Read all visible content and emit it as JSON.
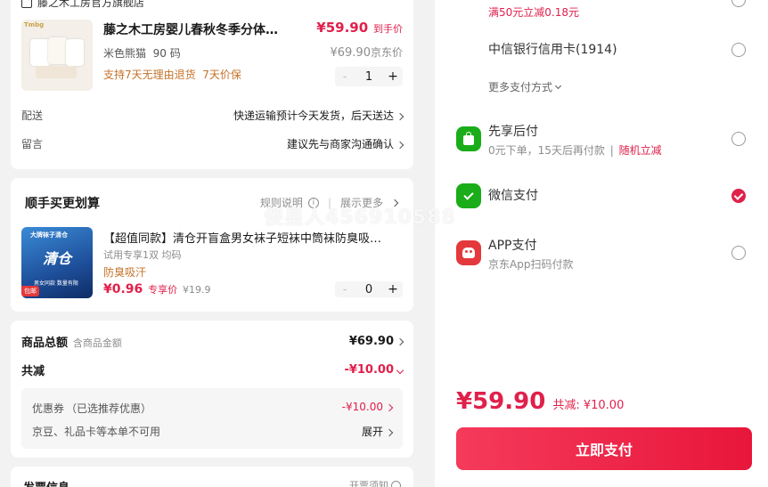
{
  "shop": {
    "name": "藤之木工房官方旗舰店"
  },
  "product": {
    "title": "藤之木工房婴儿春秋冬季分体…",
    "price": "¥59.90",
    "price_tag": "到手价",
    "spec": "米色熊猫  90 码",
    "jd_price": "¥69.90",
    "jd_price_tag": "京东价",
    "service": "支持7天无理由退货  7天价保",
    "quantity": "1",
    "minus": "-",
    "plus": "+",
    "thumb_brand": "Tmbg"
  },
  "delivery": {
    "label": "配送",
    "value": "快递运输预计今天发货，后天送达"
  },
  "message": {
    "label": "留言",
    "value": "建议先与商家沟通确认"
  },
  "bundle": {
    "title": "顺手买更划算",
    "rules": "规则说明",
    "more": "展示更多",
    "item_title": "【超值同款】清仓开盲盒男女袜子短袜中筒袜防臭吸…",
    "item_spec": "试用专享1双 均码",
    "item_feature": "防臭吸汗",
    "item_price": "¥0.96",
    "item_price_tag": "专享价",
    "item_orig": "¥19.9",
    "quantity": "0",
    "thumb_text_top": "大牌袜子清仓",
    "thumb_text_main": "清仓",
    "thumb_text_sub": "男女同款 数量有限",
    "thumb_badge": "包邮"
  },
  "summary": {
    "total_label": "商品总额",
    "total_sub": "含商品金额",
    "total_value": "¥69.90",
    "discount_label": "共减",
    "discount_value": "-¥10.00",
    "coupon_label": "优惠券",
    "coupon_note": "（已选推荐优惠）",
    "coupon_value": "-¥10.00",
    "jd_bean_label": "京豆、礼品卡等本单不可用",
    "expand": "展开"
  },
  "invoice": {
    "title": "发票信息",
    "note": "开票须知"
  },
  "payment": {
    "promo_text": "满50元立减0.18元",
    "bank_card": "中信银行信用卡(1914)",
    "more_methods": "更多支付方式",
    "methods": [
      {
        "name": "先享后付",
        "desc": "0元下单，15天后再付款",
        "extra": "随机立减",
        "icon": "bag-icon",
        "color": "#1aad19",
        "selected": false
      },
      {
        "name": "微信支付",
        "desc": "",
        "extra": "",
        "icon": "wechat-icon",
        "color": "#1aad19",
        "selected": true
      },
      {
        "name": "APP支付",
        "desc": "京东App扫码付款",
        "extra": "",
        "icon": "jd-dog-icon",
        "color": "#e4393c",
        "selected": false
      }
    ],
    "final_price": "¥59.90",
    "final_discount": "共减: ¥10.00",
    "pay_button": "立即支付"
  },
  "watermark": "傻星人456910588",
  "colors": {
    "accent": "#e0204b",
    "wechat": "#1aad19",
    "background": "#f2f2f2"
  }
}
